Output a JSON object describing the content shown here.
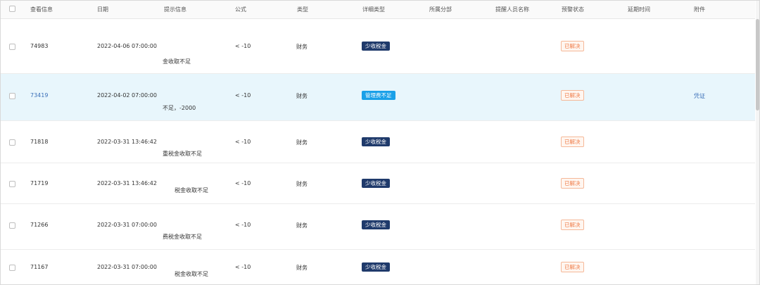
{
  "headers": [
    "查看信息",
    "日期",
    "提示信息",
    "公式",
    "类型",
    "详细类型",
    "所属分部",
    "提醒人员名称",
    "预警状态",
    "延期时间",
    "附件"
  ],
  "rows": [
    {
      "id": "74983",
      "date": "2022-04-06 07:00:00",
      "hint": "金收取不足",
      "formula": "< -10",
      "type": "财务",
      "detail": "少收税金",
      "detail_color": "navy",
      "status": "已解决",
      "attachment": "",
      "highlight": false
    },
    {
      "id": "73419",
      "date": "2022-04-02 07:00:00",
      "hint": "不足，-2000",
      "formula": "< -10",
      "type": "财务",
      "detail": "管理费不足",
      "detail_color": "blue",
      "status": "已解决",
      "attachment": "凭证",
      "highlight": true
    },
    {
      "id": "71818",
      "date": "2022-03-31 13:46:42",
      "hint": "重税金收取不足",
      "formula": "< -10",
      "type": "财务",
      "detail": "少收税金",
      "detail_color": "navy",
      "status": "已解决",
      "attachment": "",
      "highlight": false
    },
    {
      "id": "71719",
      "date": "2022-03-31 13:46:42",
      "hint": "税金收取不足",
      "formula": "< -10",
      "type": "财务",
      "detail": "少收税金",
      "detail_color": "navy",
      "status": "已解决",
      "attachment": "",
      "highlight": false
    },
    {
      "id": "71266",
      "date": "2022-03-31 07:00:00",
      "hint": "费税金收取不足",
      "formula": "< -10",
      "type": "财务",
      "detail": "少收税金",
      "detail_color": "navy",
      "status": "已解决",
      "attachment": "",
      "highlight": false
    },
    {
      "id": "71167",
      "date": "2022-03-31 07:00:00",
      "hint": "税金收取不足",
      "formula": "< -10",
      "type": "财务",
      "detail": "少收税金",
      "detail_color": "navy",
      "status": "已解决",
      "attachment": "",
      "highlight": false
    }
  ]
}
